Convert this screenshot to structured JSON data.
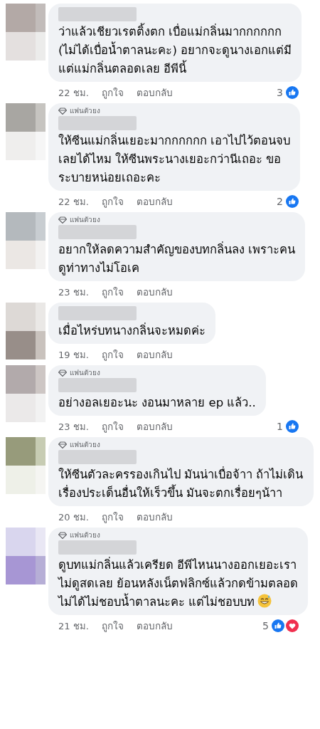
{
  "comments": [
    {
      "lines": [
        "ว่าแล้วเชียวเรตติ้งตก เบื่อแม่กลิ่นมากกกกกก",
        "(ไม่ได้เบื่อน้ำตาลนะคะ) อยากจะดูนางเอกแต่มี",
        "แต่แม่กลิ่นตลอดเลย อีพีนี้"
      ],
      "time": "22 ชม.",
      "like_label": "ถูกใจ",
      "reply_label": "ตอบกลับ",
      "reaction_count": "3",
      "reactions": [
        {
          "kind": "like"
        }
      ]
    },
    {
      "fan_badge": "แฟนตัวยง",
      "lines": [
        "ให้ซีนแม่กลิ่นเยอะมากกกกกก เอาไปไว้ตอนจบ",
        "เลยได้ไหม ให้ซีนพระนางเยอะกว่านีเถอะ ขอ",
        "ระบายหน่อยเถอะคะ"
      ],
      "time": "22 ชม.",
      "like_label": "ถูกใจ",
      "reply_label": "ตอบกลับ",
      "reaction_count": "2",
      "reactions": [
        {
          "kind": "like"
        }
      ]
    },
    {
      "fan_badge": "แฟนตัวยง",
      "lines": [
        "อยากให้ลดความสำคัญของบทกลิ่นลง เพราะคน",
        "ดูท่าทางไม่โอเค"
      ],
      "time": "23 ชม.",
      "like_label": "ถูกใจ",
      "reply_label": "ตอบกลับ"
    },
    {
      "lines": [
        "เมื่อไหร่บทนางกลิ่นจะหมดค่ะ"
      ],
      "time": "19 ชม.",
      "like_label": "ถูกใจ",
      "reply_label": "ตอบกลับ"
    },
    {
      "fan_badge": "แฟนตัวยง",
      "lines": [
        "อย่างอลเยอะนะ งอนมาหลาย ep แล้ว.."
      ],
      "time": "23 ชม.",
      "like_label": "ถูกใจ",
      "reply_label": "ตอบกลับ",
      "reaction_count": "1",
      "reactions": [
        {
          "kind": "like"
        }
      ]
    },
    {
      "fan_badge": "แฟนตัวยง",
      "lines": [
        "ให้ซีนตัวละครรองเกินไป มันน่าเบื่อจ้าา ถ้าไม่เดิน",
        "เรื่องประเด็นอื่นให้เร็วขึ้น มันจะตกเรื่อยๆน้าา"
      ],
      "time": "20 ชม.",
      "like_label": "ถูกใจ",
      "reply_label": "ตอบกลับ"
    },
    {
      "fan_badge": "แฟนตัวยง",
      "lines": [
        "ดูบทแม่กลิ่นแล้วเครียด อีพีไหนนางออกเยอะเรา",
        "ไม่ดูสดเลย ย้อนหลังเน็ตฟลิกซ์แล้วกดข้ามตลอด",
        "ไม่ได้ไม่ชอบน้ำตาลนะคะ แต่ไม่ชอบบท"
      ],
      "emoji": {
        "kind": "sweat-smile"
      },
      "time": "21 ชม.",
      "like_label": "ถูกใจ",
      "reply_label": "ตอบกลับ",
      "reaction_count": "5",
      "reactions": [
        {
          "kind": "like"
        },
        {
          "kind": "love"
        }
      ]
    }
  ]
}
